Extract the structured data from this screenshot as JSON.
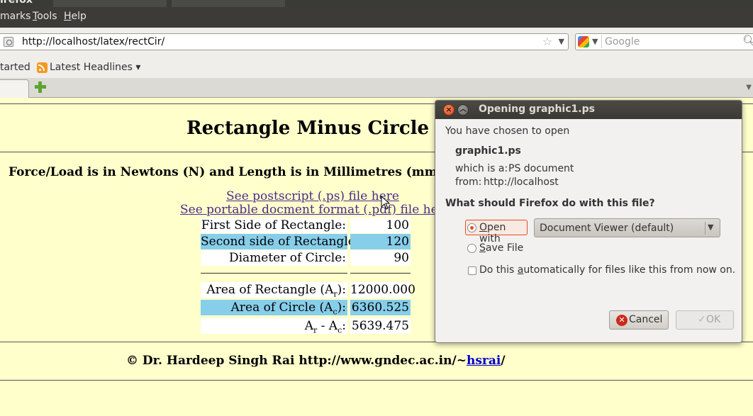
{
  "browser": {
    "window_title_fragment": "irefox",
    "menu": {
      "bookmarks": "marks",
      "tools": "Tools",
      "help": "Help"
    },
    "url": "http://localhost/latex/rectCir/",
    "search_placeholder": "Google",
    "bookmarks_bar": {
      "getting_started": "tarted",
      "latest_headlines": "Latest Headlines ▾"
    }
  },
  "page": {
    "title": "Rectangle Minus Circle",
    "units_note": "Force/Load is in Newtons (N) and Length is in Millimetres (mm), u",
    "links": {
      "postscript": "See postscript (.ps) file here",
      "pdf": "See portable docment format (.pdf) file here"
    },
    "inputs": [
      {
        "label": "First Side of Rectangle:",
        "value": "100"
      },
      {
        "label": "Second side of Rectangle:",
        "value": "120"
      },
      {
        "label": "Diameter of Circle:",
        "value": "90"
      }
    ],
    "results": {
      "area_rect_label": "Area of Rectangle (A",
      "area_rect_sub": "r",
      "area_rect_tail": "):",
      "area_rect_value": "12000.000",
      "area_circle_label": "Area of Circle (A",
      "area_circle_sub": "c",
      "area_circle_tail": "):",
      "area_circle_value": "6360.525",
      "diff_a1": "A",
      "diff_sub1": "r",
      "diff_mid": " - A",
      "diff_sub2": "c",
      "diff_tail": ":",
      "diff_value": "5639.475"
    },
    "footer": {
      "text": "© Dr. Hardeep Singh Rai http://www.gndec.ac.in/~",
      "link": "hsrai",
      "slash": "/"
    }
  },
  "dialog": {
    "title": "Opening graphic1.ps",
    "intro": "You have chosen to open",
    "filename": "graphic1.ps",
    "which_is_label": "which is a:",
    "which_is_value": "PS document",
    "from_label": "from:",
    "from_value": "http://localhost",
    "question": "What should Firefox do with this file?",
    "open_with_label": "Open with",
    "open_with_app": "Document Viewer (default)",
    "save_file_label": "Save File",
    "auto_label": "Do this automatically for files like this from now on.",
    "cancel_label": "Cancel",
    "ok_label": "OK",
    "selected_option": "open_with",
    "auto_checked": false
  },
  "colors": {
    "page_bg": "#ffffcc",
    "row_highlight": "#87ceeb",
    "link": "#4b2c87",
    "radio_accent": "#e0501f",
    "menubar_bg": "#3c3b37"
  }
}
